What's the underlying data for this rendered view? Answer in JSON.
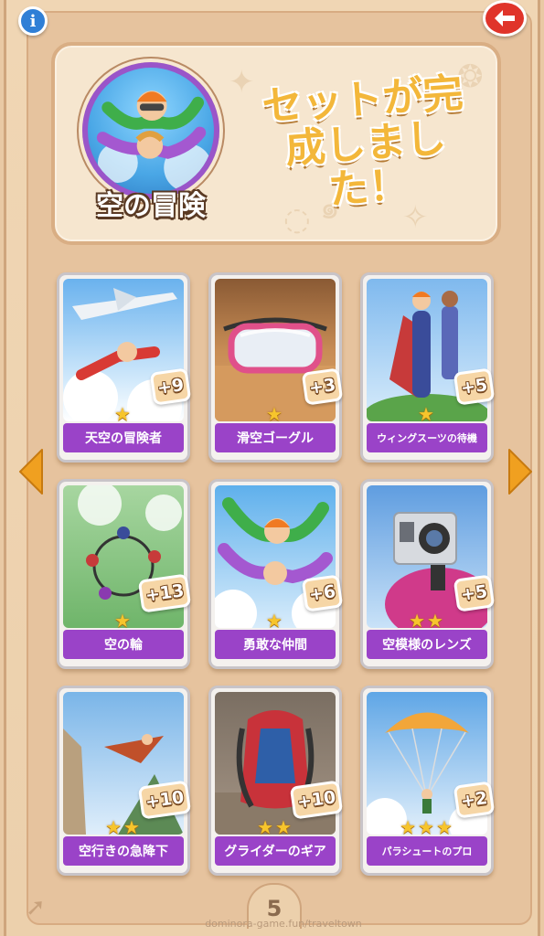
{
  "header": {
    "set_name": "空の冒険",
    "complete_message": "セットが完成しました！"
  },
  "buttons": {
    "info": "i"
  },
  "cards": [
    {
      "name": "天空の冒険者",
      "stars": "★",
      "bonus": "+9"
    },
    {
      "name": "滑空ゴーグル",
      "stars": "★",
      "bonus": "+3"
    },
    {
      "name": "ウィングスーツの待機",
      "stars": "★",
      "bonus": "+5"
    },
    {
      "name": "空の輪",
      "stars": "★",
      "bonus": "+13"
    },
    {
      "name": "勇敢な仲間",
      "stars": "★",
      "bonus": "+6"
    },
    {
      "name": "空模様のレンズ",
      "stars": "★★",
      "bonus": "+5"
    },
    {
      "name": "空行きの急降下",
      "stars": "★★",
      "bonus": "+10"
    },
    {
      "name": "グライダーのギア",
      "stars": "★★",
      "bonus": "+10"
    },
    {
      "name": "パラシュートのプロ",
      "stars": "★★★",
      "bonus": "+2"
    }
  ],
  "footer": {
    "page_number": "5",
    "watermark": "dominora-game.fun/traveltown"
  },
  "colors": {
    "card_label": "#9a43c8",
    "star": "#f7c52c",
    "title_yellow": "#f3b73a",
    "back_button": "#e0342a",
    "info_button": "#2f7fd6",
    "nav_arrow": "#f0a020"
  }
}
